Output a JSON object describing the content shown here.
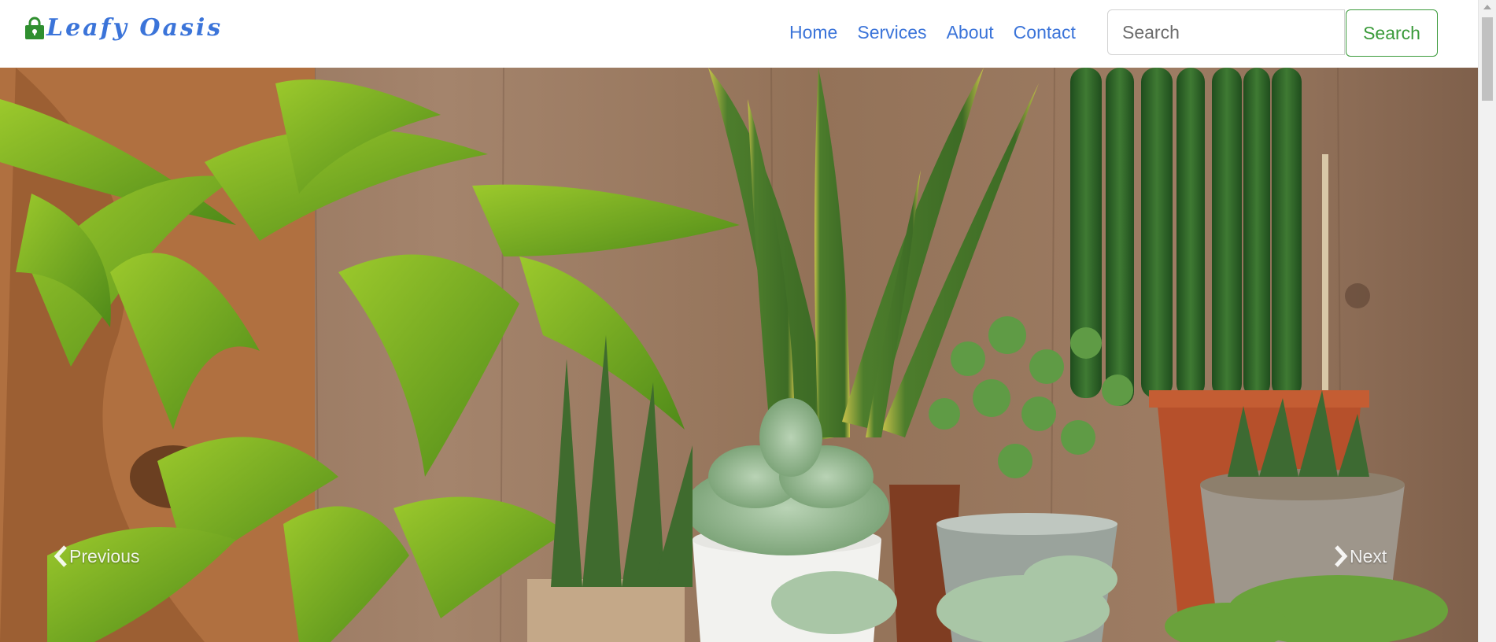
{
  "brand": {
    "name": "Leafy Oasis",
    "icon": "shopping-bag-icon",
    "icon_color": "#2f8f2f",
    "text_color": "#3b74d9"
  },
  "nav": {
    "links": [
      "Home",
      "Services",
      "About",
      "Contact"
    ],
    "link_color": "#3b74d9"
  },
  "search": {
    "placeholder": "Search",
    "button_label": "Search",
    "button_color": "#3a9a3a"
  },
  "carousel": {
    "image_description_icon": "potted-plants-photo",
    "prev_label": "Previous",
    "next_label": "Next",
    "prev_icon": "chevron-left-icon",
    "next_icon": "chevron-right-icon"
  }
}
